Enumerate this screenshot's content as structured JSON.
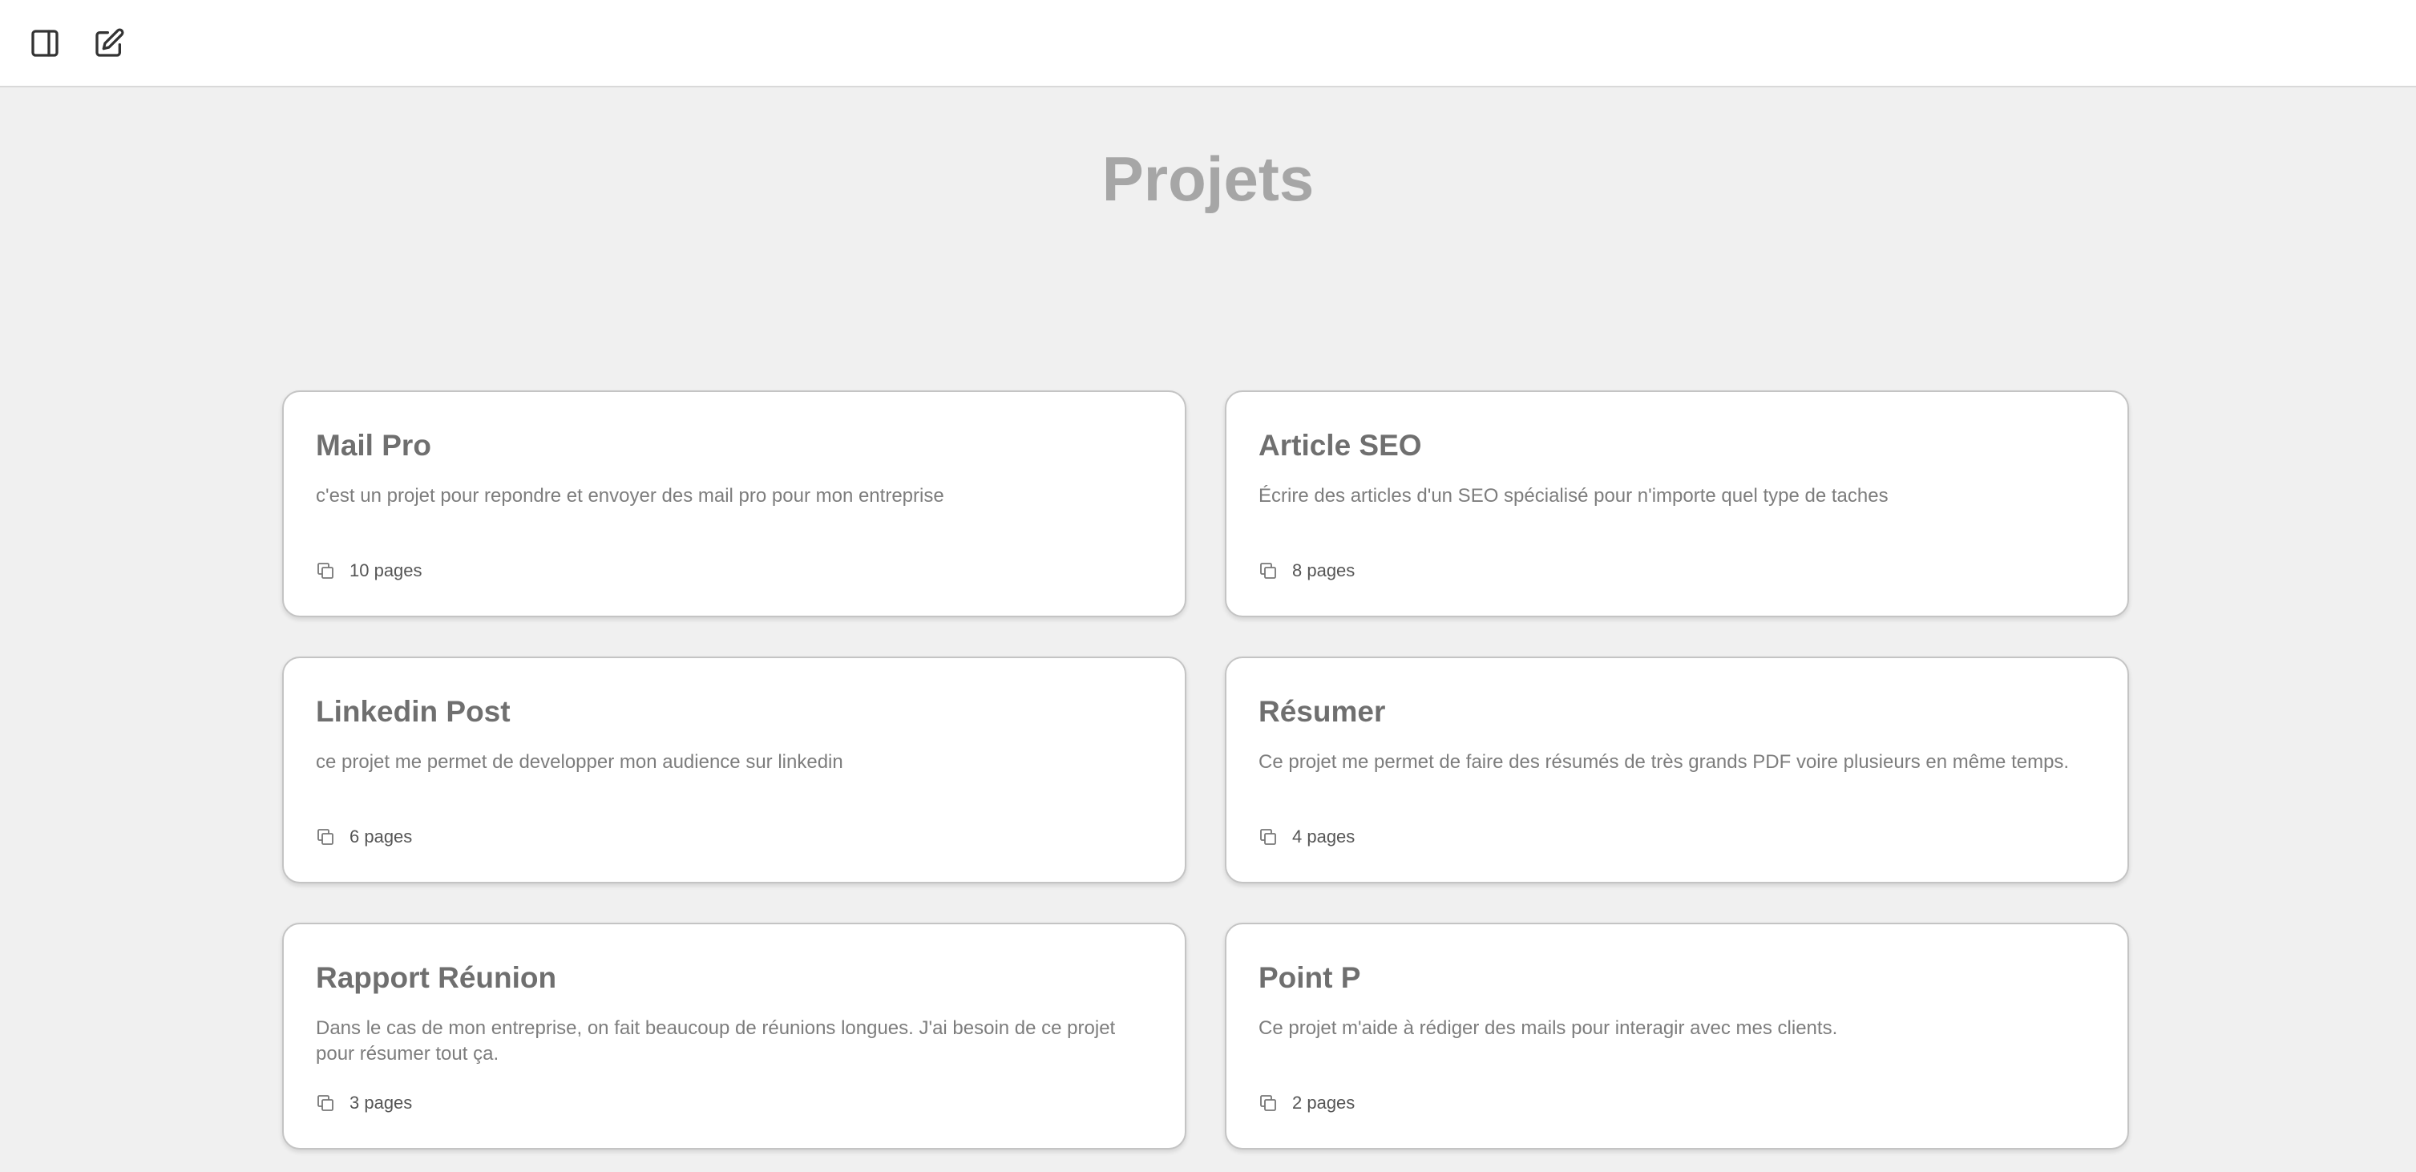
{
  "toolbar": {
    "sidebar_icon": "sidebar-toggle-icon",
    "new_icon": "edit-icon"
  },
  "page": {
    "title": "Projets"
  },
  "projects": [
    {
      "title": "Mail Pro",
      "description": "c'est un projet pour repondre et envoyer des mail pro pour mon entreprise",
      "pages": "10 pages"
    },
    {
      "title": "Article SEO",
      "description": "Écrire des articles d'un SEO spécialisé pour n'importe quel type de taches",
      "pages": "8 pages"
    },
    {
      "title": "Linkedin Post",
      "description": "ce projet me permet de developper mon audience sur linkedin",
      "pages": "6 pages"
    },
    {
      "title": "Résumer",
      "description": "Ce projet me permet de faire des résumés de très grands PDF voire plusieurs en même temps.",
      "pages": "4 pages"
    },
    {
      "title": "Rapport Réunion",
      "description": "Dans le cas de mon entreprise, on fait beaucoup de réunions longues. J'ai besoin de ce projet pour résumer tout ça.",
      "pages": "3 pages"
    },
    {
      "title": "Point P",
      "description": "Ce projet m'aide à rédiger des mails pour interagir avec mes clients.",
      "pages": "2 pages"
    }
  ],
  "colors": {
    "background": "#f0f0f0",
    "card_background": "#ffffff",
    "title_text": "#a6a6a6",
    "card_title_text": "#6f6f6f"
  }
}
